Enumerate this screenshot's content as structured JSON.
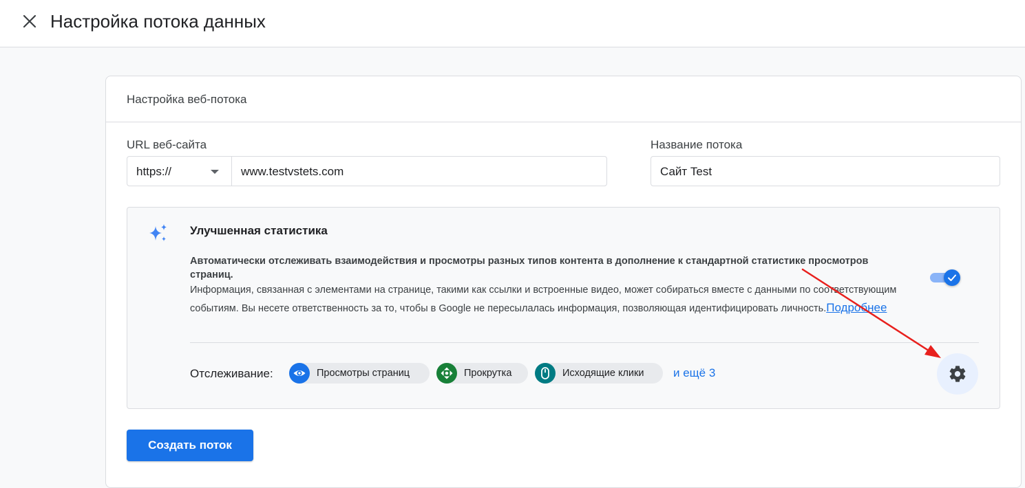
{
  "header": {
    "title": "Настройка потока данных"
  },
  "card": {
    "title": "Настройка веб-потока",
    "url_field": {
      "label": "URL веб-сайта",
      "protocol": "https://",
      "value": "www.testvstets.com"
    },
    "name_field": {
      "label": "Название потока",
      "value": "Сайт Test"
    },
    "enhanced": {
      "title": "Улучшенная статистика",
      "description_bold": "Автоматически отслеживать взаимодействия и просмотры разных типов контента в дополнение к стандартной статистике просмотров страниц.",
      "description": "Информация, связанная с элементами на странице, такими как ссылки и встроенные видео, может собираться вместе с данными по соответствующим событиям. Вы несете ответственность за то, чтобы в Google не пересылалась информация, позволяющая идентифицировать личность.",
      "learn_more": "Подробнее",
      "toggle_on": true,
      "tracking_label": "Отслеживание:",
      "chips": [
        {
          "label": "Просмотры страниц",
          "icon": "eye-icon",
          "color": "#1a73e8"
        },
        {
          "label": "Прокрутка",
          "icon": "scroll-arrows-icon",
          "color": "#188038"
        },
        {
          "label": "Исходящие клики",
          "icon": "mouse-icon",
          "color": "#007b83"
        }
      ],
      "more": "и ещё 3"
    },
    "create_button": "Создать поток"
  },
  "colors": {
    "accent": "#1a73e8",
    "annotation_arrow": "#e8201d"
  }
}
